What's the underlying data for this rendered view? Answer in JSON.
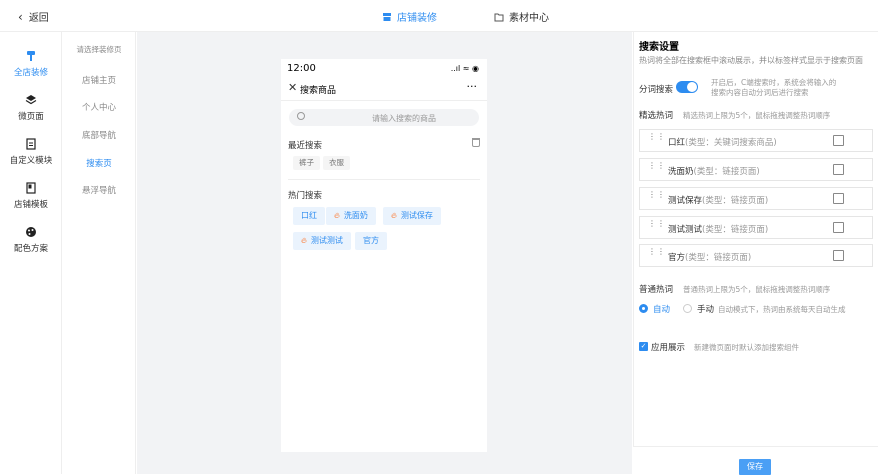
{
  "topbar": {
    "back_label": "返回",
    "tabs": [
      {
        "label": "店铺装修",
        "icon": "store-icon"
      },
      {
        "label": "素材中心",
        "icon": "folder-icon"
      }
    ]
  },
  "leftnav": {
    "items": [
      {
        "label": "全店装修",
        "icon": "paintbrush-icon"
      },
      {
        "label": "微页面",
        "icon": "layers-icon"
      },
      {
        "label": "自定义模块",
        "icon": "module-icon"
      },
      {
        "label": "店铺模板",
        "icon": "template-icon"
      },
      {
        "label": "配色方案",
        "icon": "palette-icon"
      }
    ]
  },
  "subnav": {
    "title": "请选择装修页",
    "items": [
      "店铺主页",
      "个人中心",
      "底部导航",
      "搜索页",
      "悬浮导航"
    ]
  },
  "phone": {
    "time": "12:00",
    "signal": "..ıl ≈ ◉",
    "header_title": "搜索商品",
    "close_glyph": "✕",
    "more_glyph": "···",
    "search_placeholder": "请输入搜索的商品",
    "recent_title": "最近搜索",
    "recent_tags": [
      "裤子",
      "衣服"
    ],
    "hot_title": "热门搜索",
    "hot_tags": [
      {
        "label": "口红",
        "fire": false
      },
      {
        "label": "洗面奶",
        "fire": true
      },
      {
        "label": "测试保存",
        "fire": true
      },
      {
        "label": "测试测试",
        "fire": true
      },
      {
        "label": "官方",
        "fire": false
      }
    ]
  },
  "panel": {
    "title": "搜索设置",
    "desc": "热词将全部在搜索框中滚动展示，并以标签样式显示于搜索页面",
    "split_label": "分词搜索",
    "split_note_1": "开启后，C端搜索时，系统会将输入的",
    "split_note_2": "搜索内容自动分词后进行搜索",
    "featured_label": "精选热词",
    "featured_note": "精选热词上限为5个，鼠标拖拽调整热词顺序",
    "featured_rows": [
      {
        "name": "口红",
        "type": "(类型：关键词搜索商品)"
      },
      {
        "name": "洗面奶",
        "type": "(类型：链接页面)"
      },
      {
        "name": "测试保存",
        "type": "(类型：链接页面)"
      },
      {
        "name": "测试测试",
        "type": "(类型：链接页面)"
      },
      {
        "name": "官方",
        "type": "(类型：链接页面)"
      }
    ],
    "normal_label": "普通热词",
    "normal_note": "普通热词上限为5个，鼠标拖拽调整热词顺序",
    "auto_label": "自动",
    "manual_label": "手动",
    "auto_note": "自动模式下，热词由系统每天自动生成",
    "apply_label": "应用展示",
    "apply_note": "新建微页面时默认添加搜索组件",
    "save_label": "保存"
  },
  "colors": {
    "accent": "#2d8cf0",
    "fire": "#ff6b1a",
    "canvas_bg": "#f2f3f5"
  }
}
